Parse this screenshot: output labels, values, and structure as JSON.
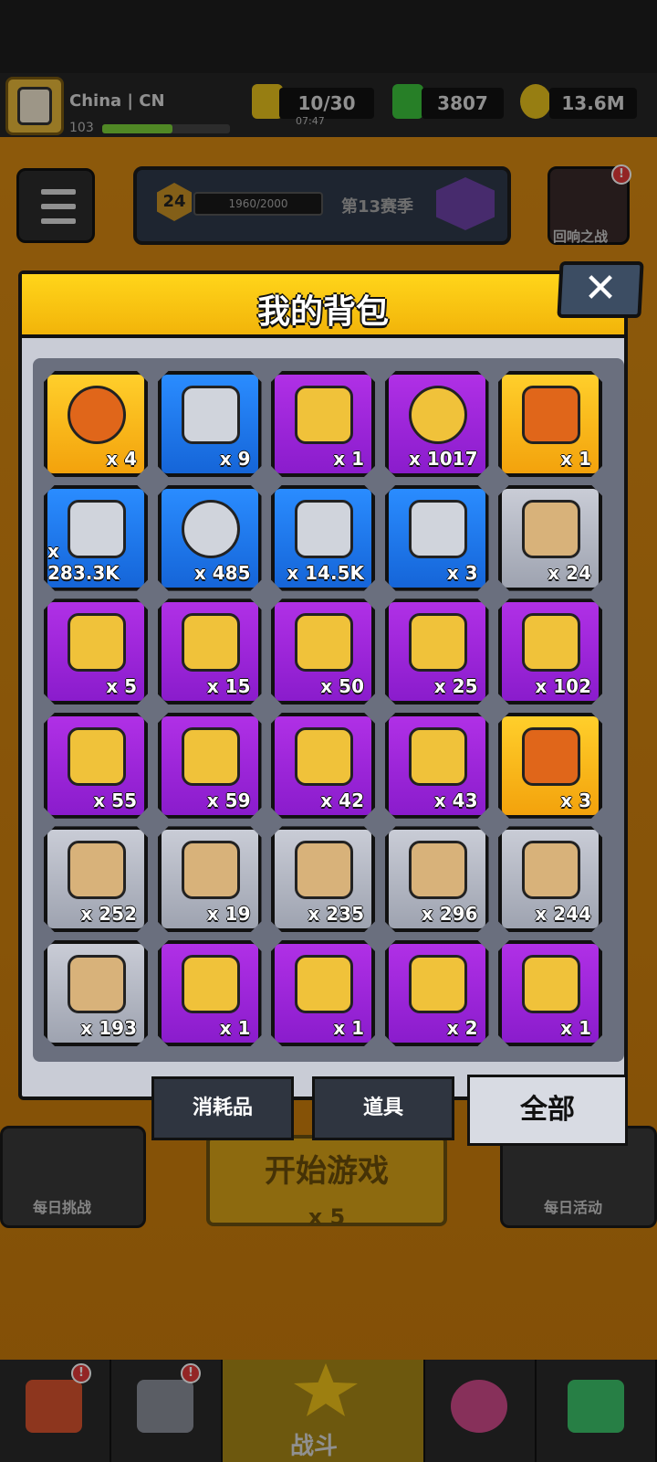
{
  "player": {
    "name": "China | CN",
    "level": "103"
  },
  "resources": {
    "energy": "10/30",
    "energy_timer": "07:47",
    "gems": "3807",
    "gold": "13.6M"
  },
  "season": {
    "level": "24",
    "progress_text": "1960/2000",
    "title": "第13赛季"
  },
  "events": {
    "echo_battle": "回响之战",
    "daily_challenge": "每日挑战",
    "daily_event": "每日活动"
  },
  "start_game": {
    "label": "开始游戏",
    "cost": "x 5"
  },
  "nav": {
    "battle": "战斗",
    "badge": "!"
  },
  "modal": {
    "title": "我的背包",
    "close": "✕",
    "tabs": [
      {
        "label": "消耗品",
        "active": false
      },
      {
        "label": "道具",
        "active": false
      },
      {
        "label": "全部",
        "active": true
      }
    ]
  },
  "items": [
    {
      "icon": "dna-orb-icon",
      "rarity": "gold",
      "qty": "x 4"
    },
    {
      "icon": "silver-key-icon",
      "rarity": "blue",
      "qty": "x 9"
    },
    {
      "icon": "gold-key-icon",
      "rarity": "purple",
      "qty": "x 1"
    },
    {
      "icon": "heart-coin-icon",
      "rarity": "purple",
      "qty": "x 1017"
    },
    {
      "icon": "crystal-key-icon",
      "rarity": "gold",
      "qty": "x 1"
    },
    {
      "icon": "flame-drop-icon",
      "rarity": "blue",
      "qty": "x 283.3K"
    },
    {
      "icon": "cube-coin-icon",
      "rarity": "blue",
      "qty": "x 485"
    },
    {
      "icon": "dog-cookie-icon",
      "rarity": "blue",
      "qty": "x 14.5K"
    },
    {
      "icon": "paw-key-icon",
      "rarity": "blue",
      "qty": "x 3"
    },
    {
      "icon": "metal-cube-icon",
      "rarity": "gray",
      "qty": "x 24"
    },
    {
      "icon": "capsule-icon",
      "rarity": "purple",
      "qty": "x 5"
    },
    {
      "icon": "crystal-shard-icon",
      "rarity": "purple",
      "qty": "x 15"
    },
    {
      "icon": "puzzle-piece-icon",
      "rarity": "purple",
      "qty": "x 50"
    },
    {
      "icon": "puzzle-piece-icon",
      "rarity": "purple",
      "qty": "x 25"
    },
    {
      "icon": "puzzle-piece-icon",
      "rarity": "purple",
      "qty": "x 102"
    },
    {
      "icon": "puzzle-piece-icon",
      "rarity": "purple",
      "qty": "x 55"
    },
    {
      "icon": "puzzle-piece-icon",
      "rarity": "purple",
      "qty": "x 59"
    },
    {
      "icon": "puzzle-piece-icon",
      "rarity": "purple",
      "qty": "x 42"
    },
    {
      "icon": "puzzle-piece-icon",
      "rarity": "purple",
      "qty": "x 43"
    },
    {
      "icon": "gold-chest-icon",
      "rarity": "gold",
      "qty": "x 3"
    },
    {
      "icon": "blueprint-gun-icon",
      "rarity": "gray",
      "qty": "x 252"
    },
    {
      "icon": "blueprint-shirt-icon",
      "rarity": "gray",
      "qty": "x 19"
    },
    {
      "icon": "blueprint-necklace-icon",
      "rarity": "gray",
      "qty": "x 235"
    },
    {
      "icon": "blueprint-belt-icon",
      "rarity": "gray",
      "qty": "x 296"
    },
    {
      "icon": "blueprint-glove-icon",
      "rarity": "gray",
      "qty": "x 244"
    },
    {
      "icon": "blueprint-boot-icon",
      "rarity": "gray",
      "qty": "x 193"
    },
    {
      "icon": "purple-chest-icon",
      "rarity": "purple",
      "qty": "x 1"
    },
    {
      "icon": "purple-chest-s-icon",
      "rarity": "purple",
      "qty": "x 1"
    },
    {
      "icon": "gold-chest-s-icon",
      "rarity": "purple",
      "qty": "x 2"
    },
    {
      "icon": "hex-chest-icon",
      "rarity": "purple",
      "qty": "x 1"
    }
  ],
  "colors": {
    "gold": "#f3a20c",
    "blue": "#1565d8",
    "purple": "#8a1ccc",
    "gray": "#9ea3b0",
    "header": "#ffd51a"
  }
}
